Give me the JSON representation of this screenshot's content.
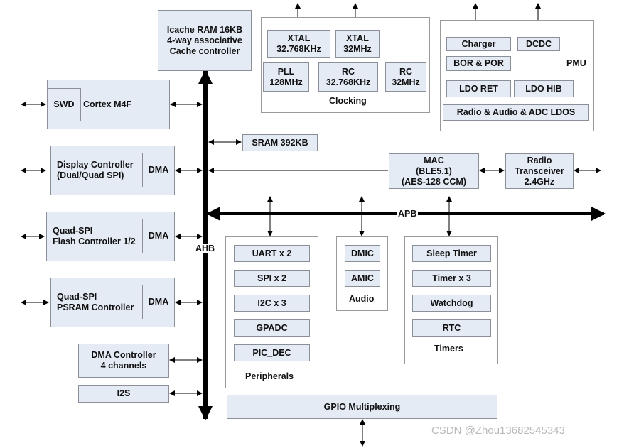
{
  "icache": "Icache RAM 16KB\n4-way associative\nCache controller",
  "cortex": {
    "swd": "SWD",
    "label": "Cortex M4F"
  },
  "display": {
    "label": "Display Controller\n(Dual/Quad SPI)",
    "dma": "DMA"
  },
  "qspi_flash": {
    "label": "Quad-SPI\nFlash Controller 1/2",
    "dma": "DMA"
  },
  "qspi_psram": {
    "label": "Quad-SPI\nPSRAM Controller",
    "dma": "DMA"
  },
  "dma_controller": "DMA Controller\n4 channels",
  "i2s": "I2S",
  "ahb": "AHB",
  "apb": "APB",
  "sram": "SRAM 392KB",
  "clocking": {
    "title": "Clocking",
    "items": [
      "XTAL\n32.768KHz",
      "XTAL\n32MHz",
      "PLL\n128MHz",
      "RC\n32.768KHz",
      "RC\n32MHz"
    ]
  },
  "pmu": {
    "title": "PMU",
    "items": [
      "Charger",
      "DCDC",
      "BOR & POR",
      "LDO RET",
      "LDO HIB",
      "Radio & Audio & ADC LDOS"
    ]
  },
  "mac": "MAC\n(BLE5.1)\n(AES-128 CCM)",
  "radio": "Radio\nTransceiver\n2.4GHz",
  "peripherals": {
    "title": "Peripherals",
    "items": [
      "UART x 2",
      "SPI x 2",
      "I2C x 3",
      "GPADC",
      "PIC_DEC"
    ]
  },
  "audio": {
    "title": "Audio",
    "items": [
      "DMIC",
      "AMIC"
    ]
  },
  "timers": {
    "title": "Timers",
    "items": [
      "Sleep Timer",
      "Timer x 3",
      "Watchdog",
      "RTC"
    ]
  },
  "gpio": "GPIO Multiplexing",
  "watermark": "CSDN @Zhou13682545343"
}
